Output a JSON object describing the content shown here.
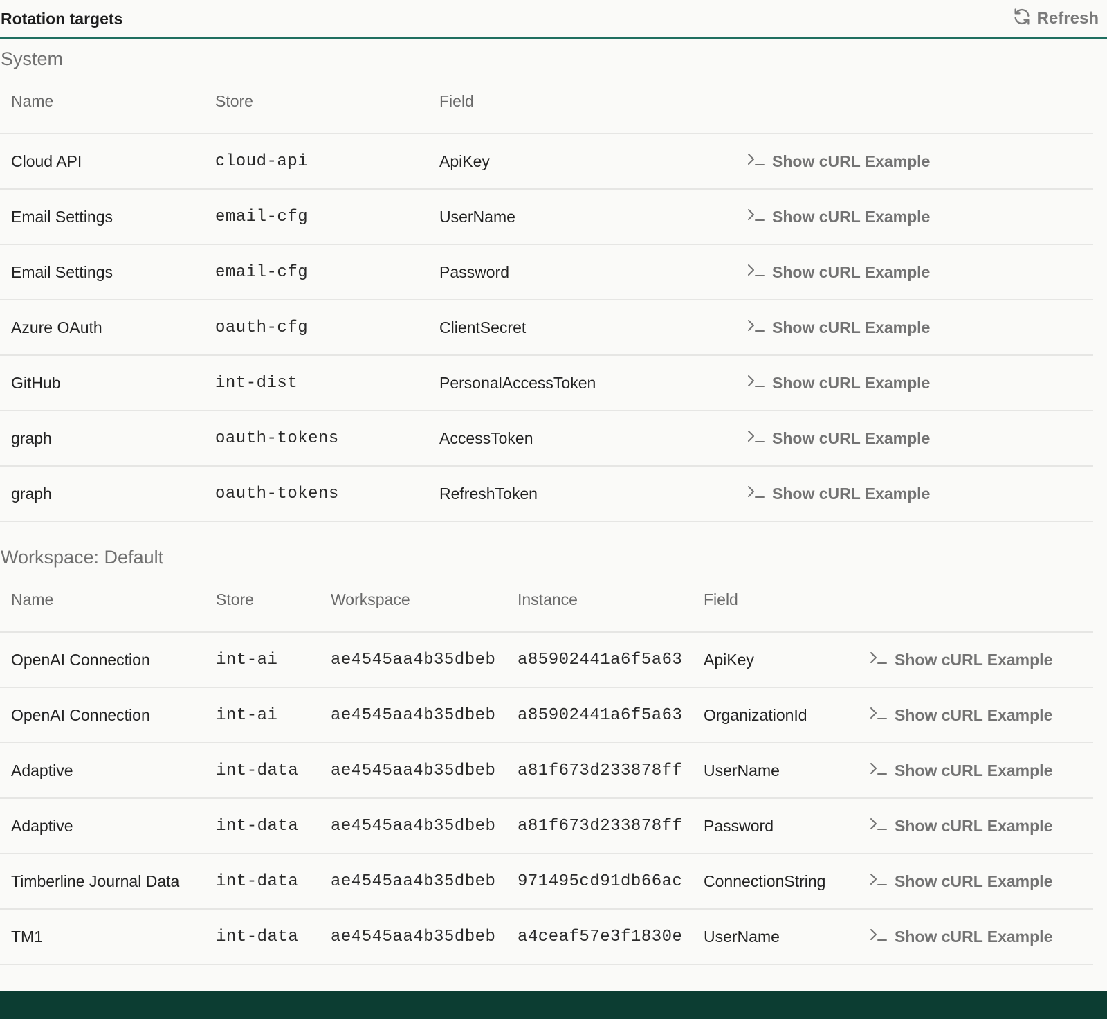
{
  "header": {
    "title": "Rotation targets",
    "refresh_label": "Refresh"
  },
  "system": {
    "title": "System",
    "columns": [
      "Name",
      "Store",
      "Field"
    ],
    "rows": [
      {
        "name": "Cloud API",
        "store": "cloud-api",
        "field": "ApiKey",
        "action": "Show cURL Example"
      },
      {
        "name": "Email Settings",
        "store": "email-cfg",
        "field": "UserName",
        "action": "Show cURL Example"
      },
      {
        "name": "Email Settings",
        "store": "email-cfg",
        "field": "Password",
        "action": "Show cURL Example"
      },
      {
        "name": "Azure OAuth",
        "store": "oauth-cfg",
        "field": "ClientSecret",
        "action": "Show cURL Example"
      },
      {
        "name": "GitHub",
        "store": "int-dist",
        "field": "PersonalAccessToken",
        "action": "Show cURL Example"
      },
      {
        "name": "graph",
        "store": "oauth-tokens",
        "field": "AccessToken",
        "action": "Show cURL Example"
      },
      {
        "name": "graph",
        "store": "oauth-tokens",
        "field": "RefreshToken",
        "action": "Show cURL Example"
      }
    ]
  },
  "workspace": {
    "title": "Workspace: Default",
    "columns": [
      "Name",
      "Store",
      "Workspace",
      "Instance",
      "Field"
    ],
    "rows": [
      {
        "name": "OpenAI Connection",
        "store": "int-ai",
        "workspace": "ae4545aa4b35dbeb",
        "instance": "a85902441a6f5a63",
        "field": "ApiKey",
        "action": "Show cURL Example"
      },
      {
        "name": "OpenAI Connection",
        "store": "int-ai",
        "workspace": "ae4545aa4b35dbeb",
        "instance": "a85902441a6f5a63",
        "field": "OrganizationId",
        "action": "Show cURL Example"
      },
      {
        "name": "Adaptive",
        "store": "int-data",
        "workspace": "ae4545aa4b35dbeb",
        "instance": "a81f673d233878ff",
        "field": "UserName",
        "action": "Show cURL Example"
      },
      {
        "name": "Adaptive",
        "store": "int-data",
        "workspace": "ae4545aa4b35dbeb",
        "instance": "a81f673d233878ff",
        "field": "Password",
        "action": "Show cURL Example"
      },
      {
        "name": "Timberline Journal Data",
        "store": "int-data",
        "workspace": "ae4545aa4b35dbeb",
        "instance": "971495cd91db66ac",
        "field": "ConnectionString",
        "action": "Show cURL Example"
      },
      {
        "name": "TM1",
        "store": "int-data",
        "workspace": "ae4545aa4b35dbeb",
        "instance": "a4ceaf57e3f1830e",
        "field": "UserName",
        "action": "Show cURL Example"
      }
    ]
  },
  "icons": {
    "refresh": "refresh-icon",
    "terminal": "terminal-icon"
  },
  "colors": {
    "accent": "#1f6f60",
    "footer": "#0c3d32",
    "muted_text": "#737373"
  }
}
